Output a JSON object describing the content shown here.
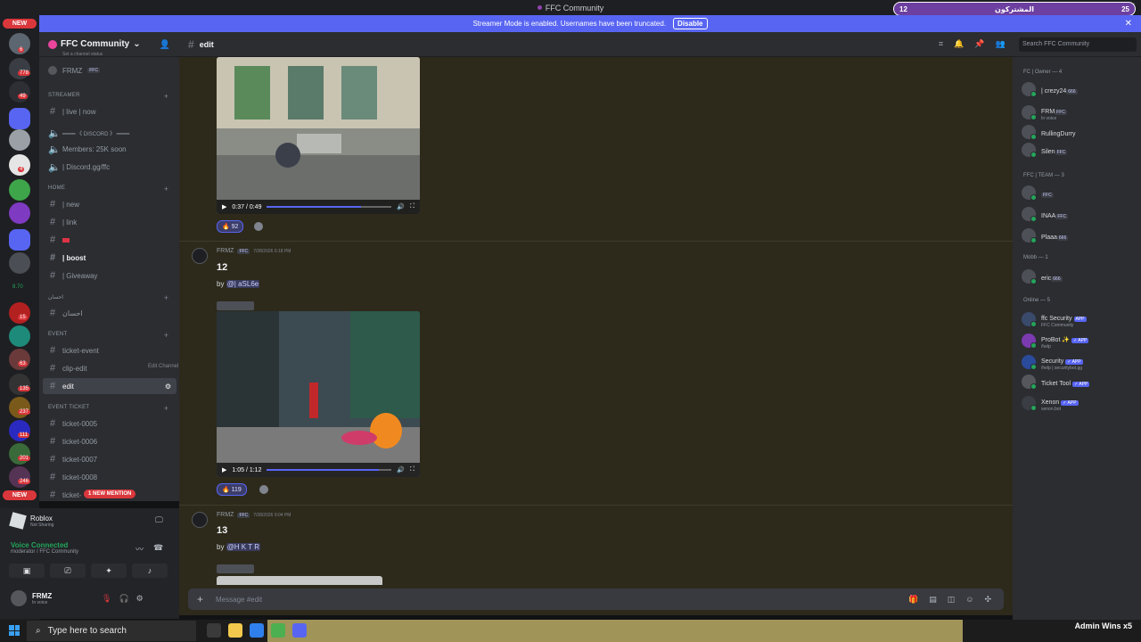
{
  "window": {
    "title": "FFC Community"
  },
  "banner": {
    "text": "Streamer Mode is enabled. Usernames have been truncated.",
    "button": "Disable"
  },
  "overlay": {
    "left_num": "12",
    "center_text": "المشتركون",
    "right_num": "25"
  },
  "rail": {
    "new_top": "NEW",
    "new_bottom": "NEW",
    "badges": [
      "6",
      "778",
      "49",
      "4",
      "8.70",
      "15",
      "63",
      "135",
      "237",
      "111",
      "201",
      "246"
    ]
  },
  "server": {
    "name": "FFC Community"
  },
  "sidebar": {
    "top_status": "Set a channel status",
    "top_user": "FRMZ",
    "top_user_tag": "FFC",
    "categories": {
      "streamer": "STREAMER",
      "home": "Home",
      "ihsan": "احسان",
      "event": "event",
      "event_ticket": "event ticket"
    },
    "channels": {
      "live": "| live | now",
      "discord_sep": "━━━━ 《 DISCORD 》 ━━━━",
      "members": "Members: 25K soon",
      "discord_link": "| Discord.gg/ffc",
      "new": "| new",
      "link": "| link",
      "boost": "| boost",
      "giveaway": "| Giveaway",
      "ihsan": "احسان",
      "ticket_event": "ticket-event",
      "clip_edit": "clip-edit",
      "edit": "edit",
      "t5": "ticket-0005",
      "t6": "ticket-0006",
      "t7": "ticket-0007",
      "t8": "ticket-0008",
      "t9": "ticket-"
    },
    "edit_tooltip": "Edit Channel",
    "mention_pill": "1 NEW MENTION"
  },
  "panel": {
    "activity_name": "Roblox",
    "activity_status": "Not Sharing",
    "voice_status": "Voice Connected",
    "voice_channel": "moderator / FFC Community",
    "user": "FRMZ",
    "user_status": "In voice"
  },
  "header": {
    "channel": "edit",
    "search_placeholder": "Search FFC Community"
  },
  "messages": [
    {
      "video_time": "0:37 / 0:49",
      "video_progress": 0.755,
      "reaction": "🔥 92"
    },
    {
      "author": "FRMZ",
      "tag": "FFC",
      "timestamp": "7/28/2026 6:18 PM",
      "title": "12",
      "by_prefix": "by",
      "by_mention": "@| aSL6e",
      "video_time": "1:05 / 1:12",
      "video_progress": 0.9,
      "reaction": "🔥 119"
    },
    {
      "author": "FRMZ",
      "tag": "FFC",
      "timestamp": "7/28/2026 9:04 PM",
      "title": "13",
      "by_prefix": "by",
      "by_mention": "@H K T R"
    }
  ],
  "input": {
    "placeholder": "Message #edit"
  },
  "members": {
    "groups": [
      {
        "label": "FC | Owner — 4"
      },
      {
        "label": "FFC | TEAM — 3"
      },
      {
        "label": "Mobb — 1"
      },
      {
        "label": "Online — 5"
      }
    ],
    "items": [
      {
        "name": "| crezy24",
        "tag": "666",
        "sub": ""
      },
      {
        "name": "FRM",
        "tag": "FFC",
        "sub": "In voice"
      },
      {
        "name": "RullingDurry",
        "tag": "",
        "sub": ""
      },
      {
        "name": "Silen",
        "tag": "FFC",
        "sub": ""
      },
      {
        "name": "",
        "tag": "FFC",
        "sub": ""
      },
      {
        "name": "INAA",
        "tag": "FFC",
        "sub": ""
      },
      {
        "name": "Plaaa",
        "tag": "666",
        "sub": ""
      },
      {
        "name": "eric",
        "tag": "666",
        "sub": ""
      },
      {
        "name": "ffc Security",
        "tag": "APP",
        "sub": "FFC Community"
      },
      {
        "name": "ProBot ✨",
        "tag": "✓ APP",
        "sub": "/help"
      },
      {
        "name": "Security",
        "tag": "✓ APP",
        "sub": "/help | securitybot.gg"
      },
      {
        "name": "Ticket Tool",
        "tag": "✓ APP",
        "sub": ""
      },
      {
        "name": "Xenon",
        "tag": "✓ APP",
        "sub": "xenon.bot"
      }
    ]
  },
  "taskbar": {
    "search_placeholder": "Type here to search",
    "right_text": "Admin Wins x5"
  },
  "colors": {
    "accent": "#5865f2",
    "danger": "#da373c",
    "online": "#23a55a",
    "chat_bg": "#2d2a1c"
  }
}
